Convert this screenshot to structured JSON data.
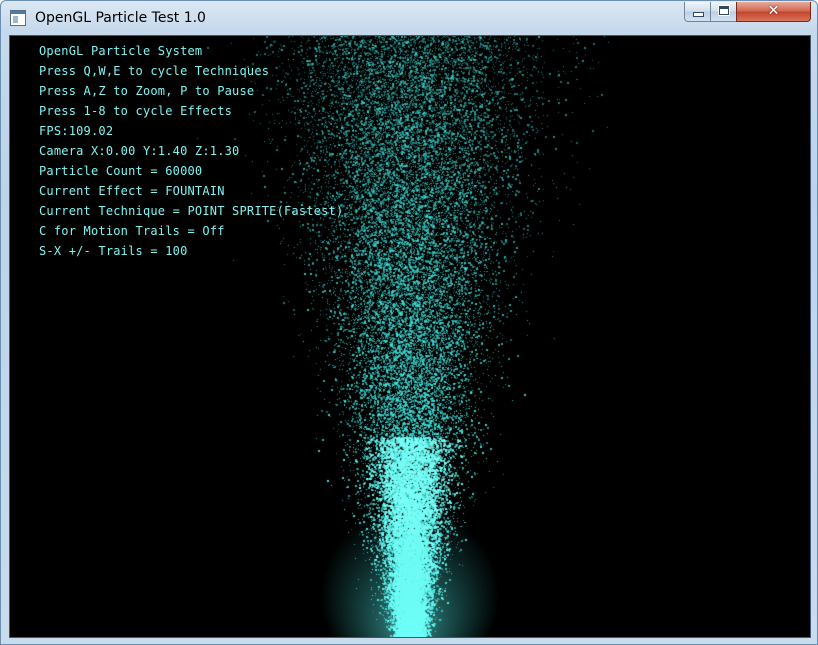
{
  "window": {
    "title": "OpenGL Particle Test 1.0",
    "app_icon": "window-app-icon",
    "buttons": {
      "minimize_icon": "minimize-icon",
      "maximize_icon": "maximize-icon",
      "close_glyph": "✕"
    }
  },
  "overlay": {
    "lines": [
      "OpenGL Particle System",
      "Press Q,W,E to cycle Techniques",
      "Press A,Z to Zoom, P to Pause",
      "Press 1-8 to cycle Effects",
      "FPS:109.02",
      "Camera X:0.00 Y:1.40 Z:1.30",
      "Particle Count = 60000",
      "Current Effect = FOUNTAIN",
      "Current Technique = POINT SPRITE(Fastest)",
      "C for Motion Trails = Off",
      "S-X +/- Trails = 100"
    ]
  },
  "scene": {
    "background_color": "#000000",
    "particle_color": "#3fe6e0",
    "effect": "FOUNTAIN"
  },
  "colors": {
    "overlay_text": "#7ff4f2",
    "close_button": "#c2442a"
  }
}
